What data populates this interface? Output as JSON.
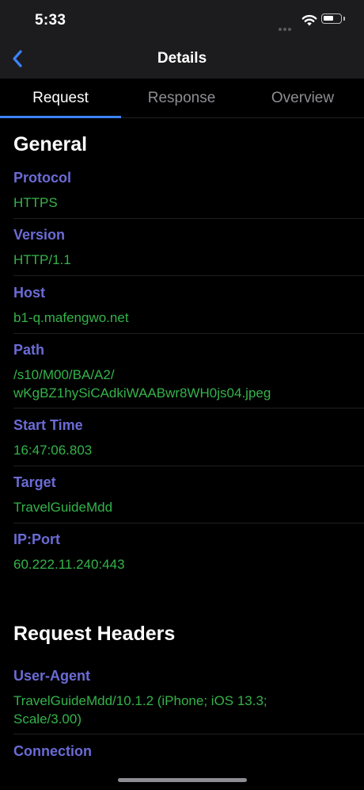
{
  "status": {
    "time": "5:33"
  },
  "nav": {
    "title": "Details"
  },
  "tabs": [
    {
      "label": "Request",
      "active": true
    },
    {
      "label": "Response",
      "active": false
    },
    {
      "label": "Overview",
      "active": false
    }
  ],
  "general": {
    "title": "General",
    "rows": [
      {
        "label": "Protocol",
        "value": "HTTPS"
      },
      {
        "label": "Version",
        "value": "HTTP/1.1"
      },
      {
        "label": "Host",
        "value": "b1-q.mafengwo.net"
      },
      {
        "label": "Path",
        "value": "/s10/M00/BA/A2/\nwKgBZ1hySiCAdkiWAABwr8WH0js04.jpeg"
      },
      {
        "label": "Start Time",
        "value": "16:47:06.803"
      },
      {
        "label": "Target",
        "value": "TravelGuideMdd"
      },
      {
        "label": "IP:Port",
        "value": "60.222.11.240:443"
      }
    ]
  },
  "request_headers": {
    "title": "Request Headers",
    "rows": [
      {
        "label": "User-Agent",
        "value": "TravelGuideMdd/10.1.2 (iPhone; iOS 13.3;\nScale/3.00)"
      },
      {
        "label": "Connection",
        "value": ""
      }
    ]
  },
  "colors": {
    "label": "#6b6bd6",
    "value": "#34b34a",
    "accent": "#3b82f6"
  },
  "icons": {
    "back": "chevron-left-icon",
    "wifi": "wifi-icon",
    "battery": "battery-icon"
  }
}
